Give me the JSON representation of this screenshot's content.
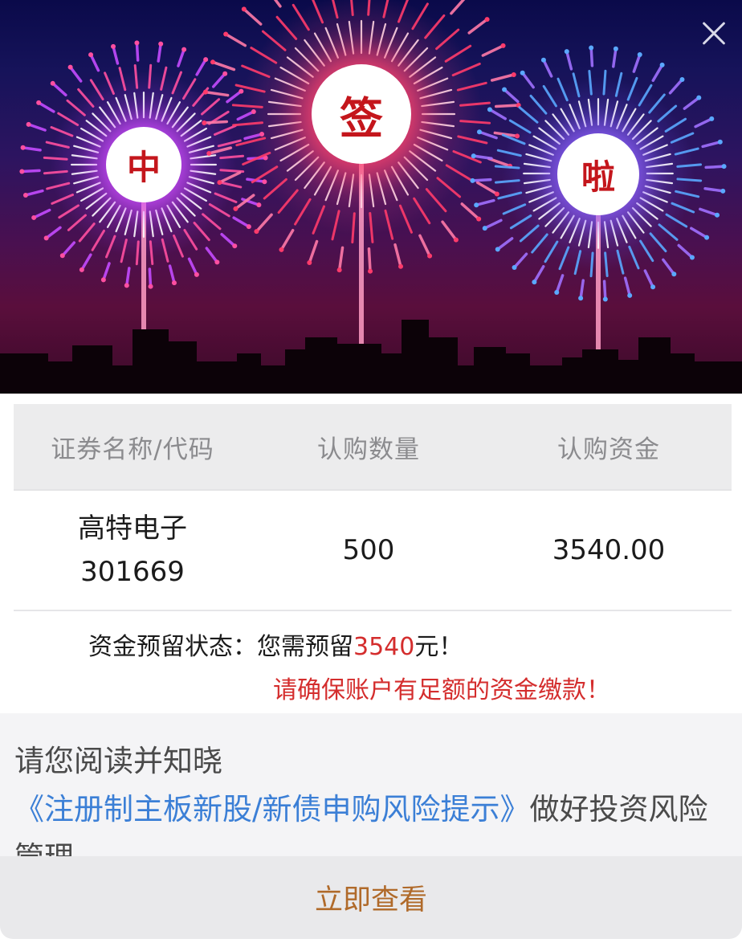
{
  "banner": {
    "characters": [
      "中",
      "签",
      "啦"
    ],
    "close_label": "close"
  },
  "table": {
    "headers": [
      "证券名称/代码",
      "认购数量",
      "认购资金"
    ],
    "row": {
      "name": "高特电子",
      "code": "301669",
      "quantity": "500",
      "amount": "3540.00"
    }
  },
  "reserve": {
    "label": "资金预留状态：",
    "prefix": "您需预留",
    "amount": "3540",
    "suffix": "元！",
    "warning": "请确保账户有足额的资金缴款！"
  },
  "notice": {
    "before": "请您阅读并知晓",
    "link": "《注册制主板新股/新债申购风险提示》",
    "after": "做好投资风险管理。"
  },
  "action": {
    "label": "立即查看"
  },
  "colors": {
    "accent_red": "#d42d2d",
    "link_blue": "#3b7fd6",
    "action_text": "#b06a2a",
    "badge_text": "#c4161c"
  }
}
